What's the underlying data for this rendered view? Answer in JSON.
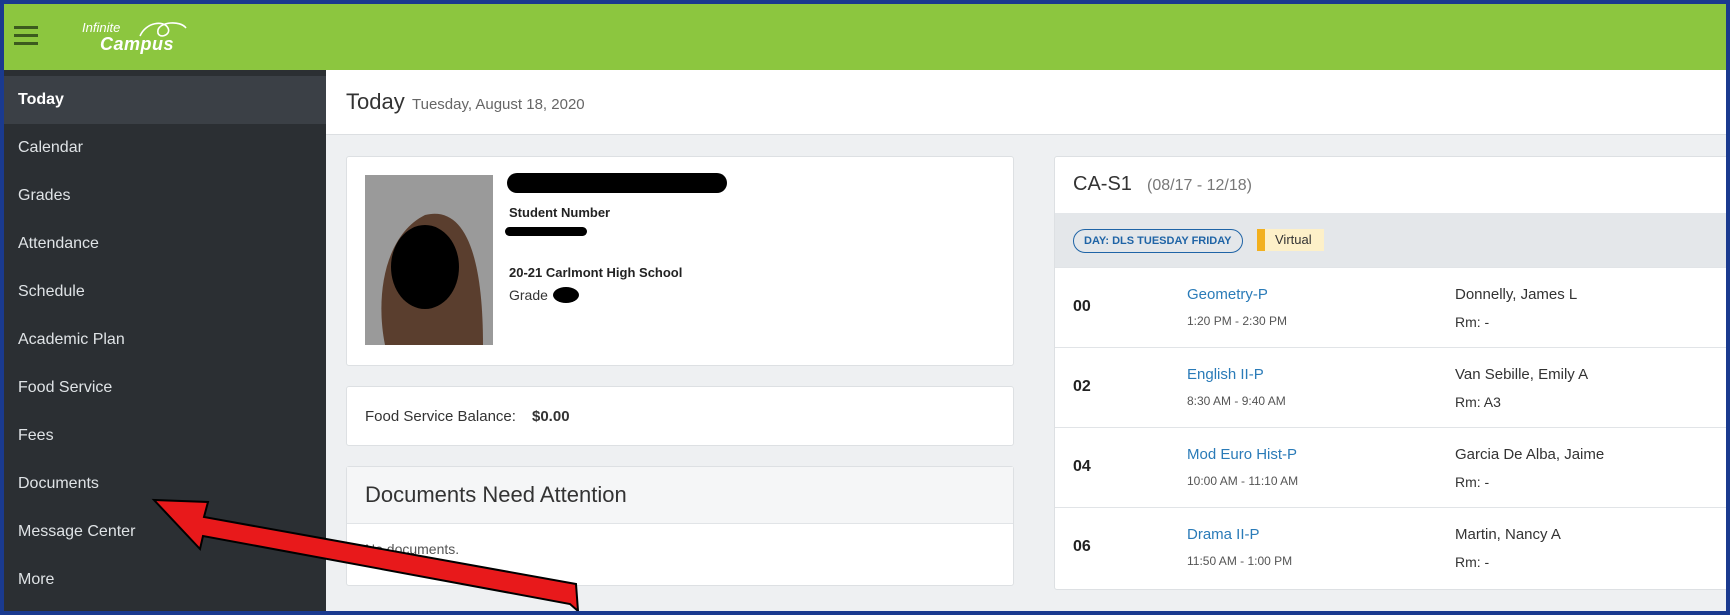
{
  "app": {
    "logo_line1": "Infinite",
    "logo_line2": "Campus"
  },
  "sidebar": {
    "items": [
      {
        "label": "Today",
        "active": true
      },
      {
        "label": "Calendar"
      },
      {
        "label": "Grades"
      },
      {
        "label": "Attendance"
      },
      {
        "label": "Schedule"
      },
      {
        "label": "Academic Plan"
      },
      {
        "label": "Food Service"
      },
      {
        "label": "Fees"
      },
      {
        "label": "Documents"
      },
      {
        "label": "Message Center"
      },
      {
        "label": "More"
      }
    ]
  },
  "header": {
    "title": "Today",
    "date": "Tuesday, August 18, 2020"
  },
  "student": {
    "number_label": "Student Number",
    "school": "20-21 Carlmont High School",
    "grade_label": "Grade"
  },
  "food": {
    "label": "Food Service Balance:",
    "balance": "$0.00"
  },
  "documents": {
    "title": "Documents Need Attention",
    "empty": "No documents."
  },
  "schedule": {
    "term": "CA-S1",
    "dates": "(08/17 - 12/18)",
    "day": "DAY: DLS TUESDAY FRIDAY",
    "mode": "Virtual",
    "periods": [
      {
        "period": "00",
        "course": "Geometry-P",
        "time": "1:20 PM - 2:30 PM",
        "teacher": "Donnelly, James L",
        "room": "Rm: -"
      },
      {
        "period": "02",
        "course": "English II-P",
        "time": "8:30 AM - 9:40 AM",
        "teacher": "Van Sebille, Emily A",
        "room": "Rm: A3"
      },
      {
        "period": "04",
        "course": "Mod Euro Hist-P",
        "time": "10:00 AM - 11:10 AM",
        "teacher": "Garcia De Alba, Jaime",
        "room": "Rm: -"
      },
      {
        "period": "06",
        "course": "Drama II-P",
        "time": "11:50 AM - 1:00 PM",
        "teacher": "Martin, Nancy A",
        "room": "Rm: -"
      }
    ]
  },
  "colors": {
    "topbar": "#8cc63f",
    "sidebar": "#2b2f33",
    "link": "#2a7bb8",
    "virtual": "#f2b01e",
    "arrow": "#e8191b",
    "border": "#1a3a8f"
  }
}
